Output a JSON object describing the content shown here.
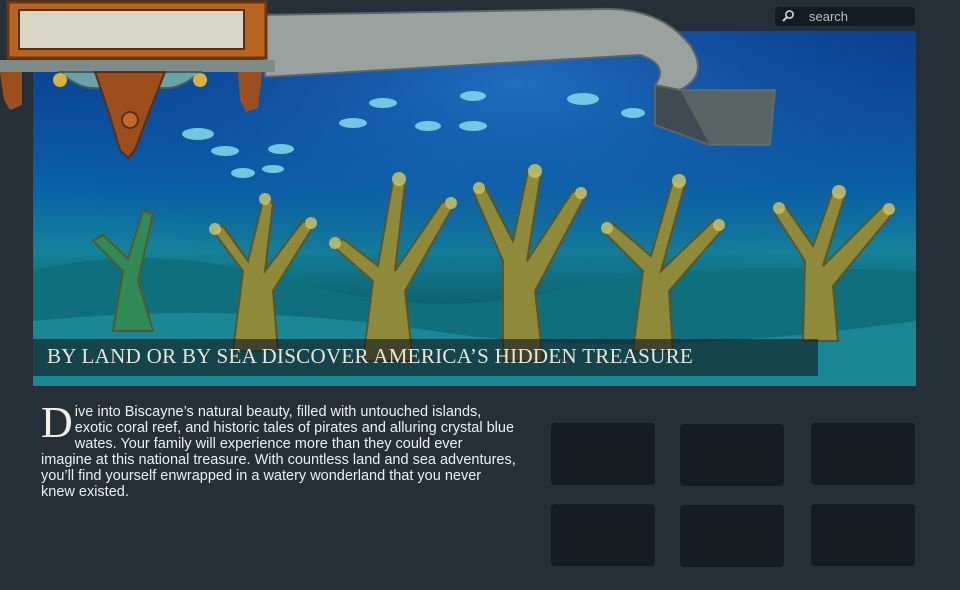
{
  "search": {
    "placeholder": "search"
  },
  "hero": {
    "tagline": "BY LAND OR BY SEA DISCOVER AMERICA’S HIDDEN TREASURE"
  },
  "intro": {
    "dropcap": "D",
    "text": "ive into Biscayne’s natural beauty, filled with untouched islands, exotic coral reef, and historic tales of pirates and alluring crystal blue wates. Your family will experience more than they could ever imagine at this national treasure. With countless land and sea adventures, you’ll find yourself enwrapped in a watery wonderland that you never knew existed."
  },
  "tiles": [
    {
      "id": "tile-1"
    },
    {
      "id": "tile-2"
    },
    {
      "id": "tile-3"
    },
    {
      "id": "tile-4"
    },
    {
      "id": "tile-5"
    },
    {
      "id": "tile-6"
    }
  ],
  "colors": {
    "background": "#252f38",
    "tile": "#141b21",
    "search_bg": "#141b22"
  }
}
